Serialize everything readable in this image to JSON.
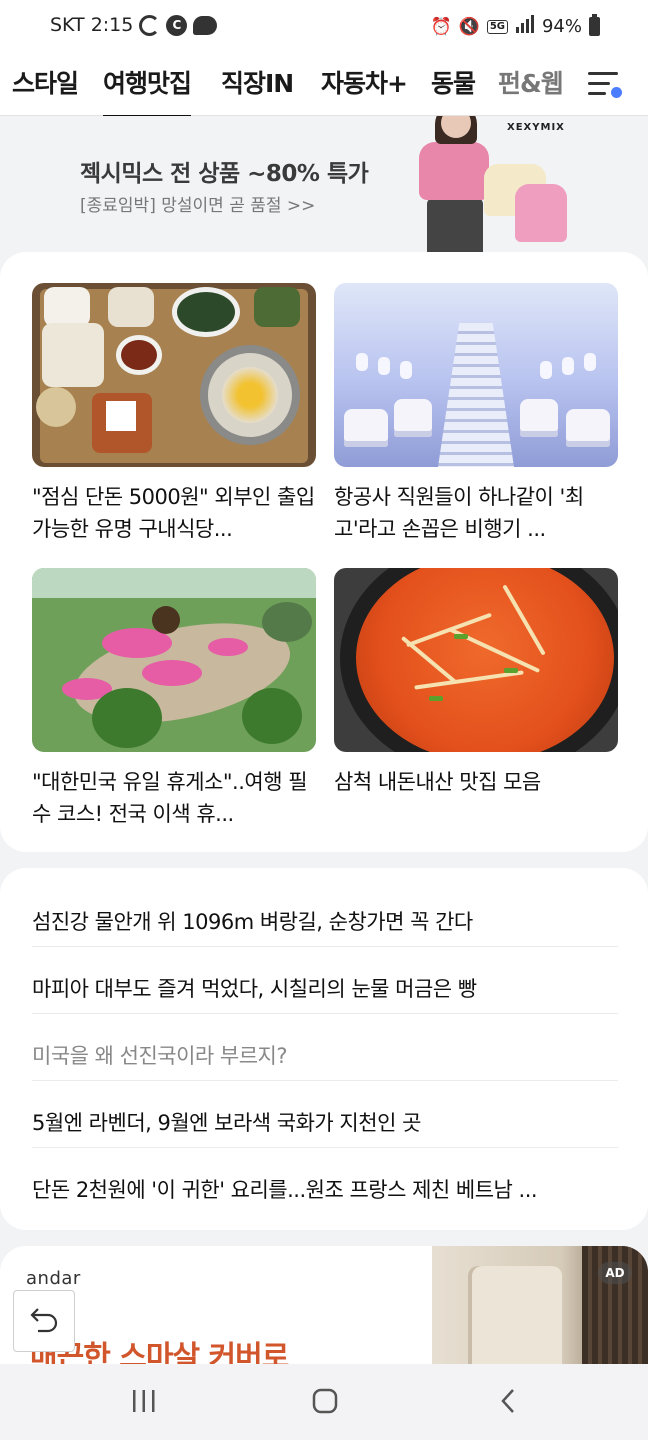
{
  "status_bar": {
    "carrier_time": "SKT 2:15",
    "network": "5G",
    "battery": "94%",
    "left_icons": [
      "google-icon",
      "c-icon",
      "chat-bubble-icon"
    ],
    "right_icons": [
      "alarm-icon",
      "mute-icon",
      "5g-icon",
      "signal-icon",
      "battery-icon"
    ]
  },
  "tabs": [
    {
      "label": "스타일"
    },
    {
      "label": "여행맛집",
      "active": true
    },
    {
      "label": "직장IN"
    },
    {
      "label": "자동차+"
    },
    {
      "label": "동물"
    },
    {
      "label": "펀&웹"
    }
  ],
  "banner": {
    "brand": "XEXYMIX",
    "title": "젝시믹스 전 상품 ~80% 특가",
    "subtitle": "[종료임박] 망설이면 곧 품절 >>"
  },
  "cards": [
    {
      "title": "\"점심 단돈 5000원\" 외부인 출입 가능한 유명 구내식당..."
    },
    {
      "title": "항공사 직원들이 하나같이 '최고'라고 손꼽은 비행기 ..."
    },
    {
      "title": "\"대한민국 유일 휴게소\"..여행 필수 코스! 전국 이색 휴..."
    },
    {
      "title": "삼척 내돈내산 맛집 모음"
    }
  ],
  "list": [
    {
      "title": "섬진강 물안개 위 1096m 벼랑길, 순창가면 꼭 간다"
    },
    {
      "title": "마피아 대부도 즐겨 먹었다, 시칠리의 눈물 머금은 빵"
    },
    {
      "title": "미국을 왜 선진국이라 부르지?"
    },
    {
      "title": "5월엔 라벤더, 9월엔 보라색 국화가 지천인 곳"
    },
    {
      "title": "단돈 2천원에 '이 귀한' 요리를...원조 프랑스 제친 베트남 ..."
    }
  ],
  "ad": {
    "brand": "andar",
    "headline": "매끈한 스마살 커버로",
    "badge": "AD"
  },
  "colors": {
    "accent_dot": "#4a7dff",
    "ad_headline": "#d2562c",
    "read_text": "#888888"
  }
}
